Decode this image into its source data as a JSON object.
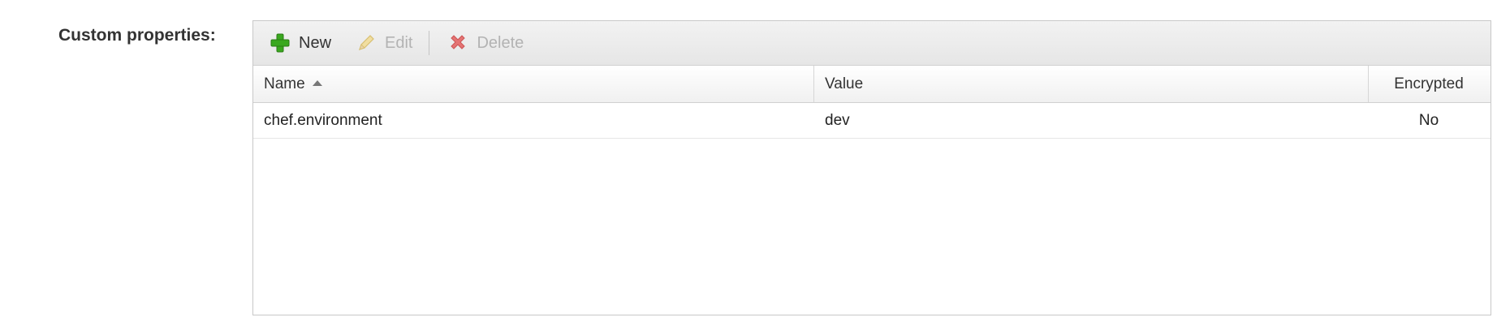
{
  "form": {
    "label": "Custom properties:"
  },
  "toolbar": {
    "new_label": "New",
    "edit_label": "Edit",
    "delete_label": "Delete"
  },
  "grid": {
    "columns": {
      "name": "Name",
      "value": "Value",
      "encrypted": "Encrypted"
    },
    "sort": {
      "column": "Name",
      "direction": "ascending"
    },
    "rows": [
      {
        "name": "chef.environment",
        "value": "dev",
        "encrypted": "No"
      }
    ]
  },
  "icons": {
    "new": "plus-icon",
    "edit": "pencil-icon",
    "delete": "x-icon",
    "sort": "sort-ascending-icon"
  },
  "colors": {
    "plus_green": "#3aa81f",
    "delete_red": "#d9534f",
    "pencil_yellow": "#e2c56b"
  }
}
